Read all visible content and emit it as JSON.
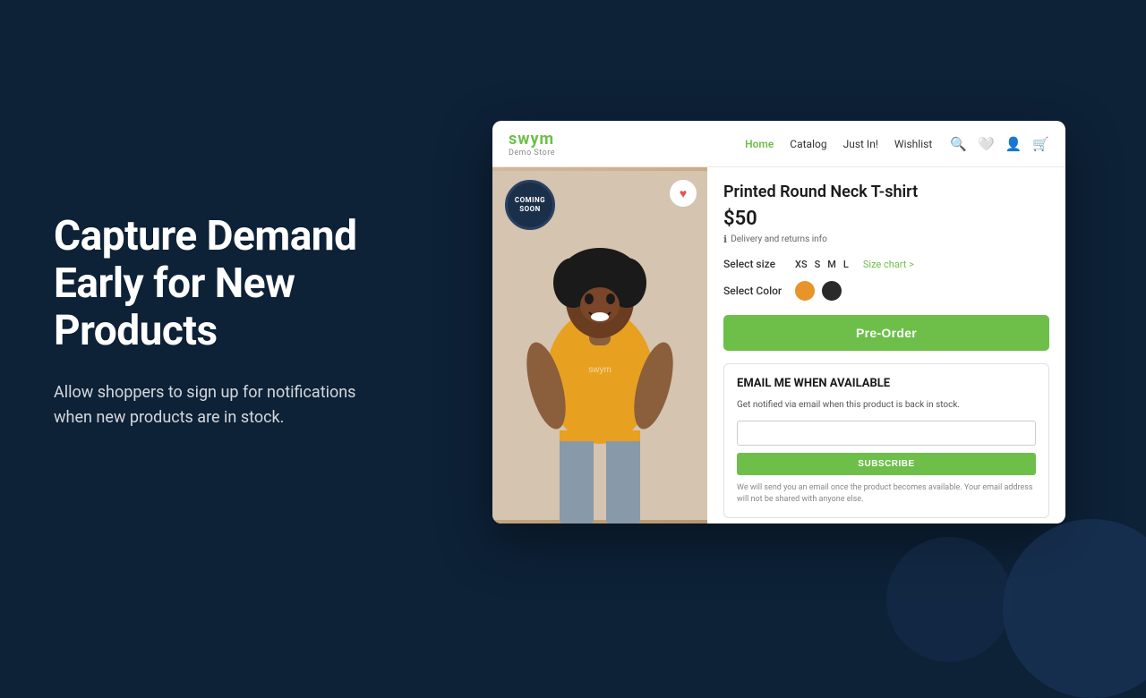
{
  "background": "#0d2137",
  "left": {
    "headline": "Capture Demand Early for New Products",
    "description": "Allow shoppers to sign up for notifications when new products are in stock."
  },
  "store": {
    "logo": {
      "name": "swym",
      "sub": "Demo Store"
    },
    "nav": {
      "links": [
        {
          "label": "Home",
          "active": true
        },
        {
          "label": "Catalog",
          "active": false
        },
        {
          "label": "Just In!",
          "active": false
        },
        {
          "label": "Wishlist",
          "active": false
        }
      ]
    },
    "product": {
      "title": "Printed Round Neck T-shirt",
      "price": "$50",
      "delivery_info": "Delivery and returns info",
      "size_label": "Select size",
      "sizes": [
        "XS",
        "S",
        "M",
        "L"
      ],
      "size_chart": "Size chart >",
      "color_label": "Select Color",
      "colors": [
        {
          "name": "orange",
          "hex": "#e8942a"
        },
        {
          "name": "black",
          "hex": "#2a2a2a"
        }
      ],
      "preorder_label": "Pre-Order",
      "coming_soon_line1": "COMING",
      "coming_soon_line2": "SOON"
    },
    "email_notify": {
      "title": "EMAIL ME WHEN AVAILABLE",
      "description": "Get notified via email when this product is back in stock.",
      "input_placeholder": "",
      "subscribe_label": "SUBSCRIBE",
      "disclaimer": "We will send you an email once the product becomes available. Your email address will not be shared with anyone else."
    }
  }
}
